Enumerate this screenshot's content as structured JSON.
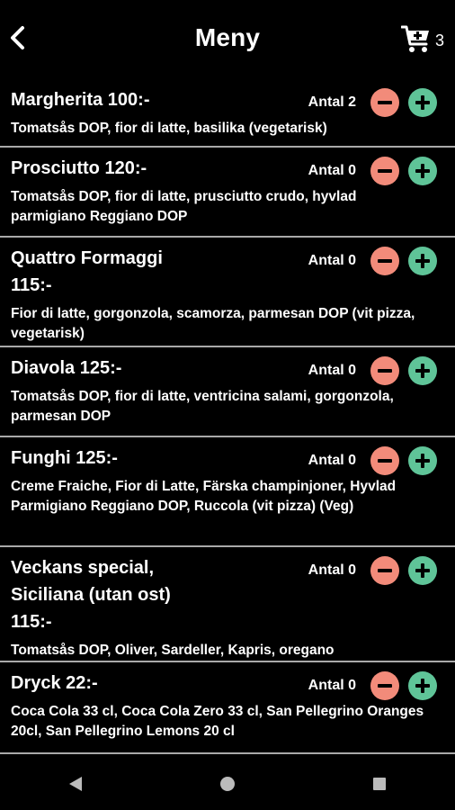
{
  "header": {
    "title": "Meny",
    "cart_count": "3"
  },
  "items": [
    {
      "name": "Margherita 100:-",
      "qty_label": "Antal 2",
      "desc": "Tomatsås DOP, fior di latte, basilika (vegetarisk)"
    },
    {
      "name": "Prosciutto 120:-",
      "qty_label": "Antal 0",
      "desc": "Tomatsås DOP, fior di latte, prusciutto crudo, hyvlad parmigiano Reggiano DOP"
    },
    {
      "name": "Quattro Formaggi 115:-",
      "qty_label": "Antal 0",
      "desc": "Fior di latte, gorgonzola, scamorza, parmesan DOP (vit pizza, vegetarisk)"
    },
    {
      "name": "Diavola 125:-",
      "qty_label": "Antal 0",
      "desc": "Tomatsås DOP, fior di latte, ventricina salami, gorgonzola, parmesan DOP"
    },
    {
      "name": "Funghi 125:-",
      "qty_label": "Antal 0",
      "desc": "Creme Fraiche, Fior di Latte, Färska champinjoner, Hyvlad Parmigiano Reggiano DOP, Ruccola (vit pizza) (Veg)"
    },
    {
      "name": "Veckans special, Siciliana (utan ost) 115:-",
      "qty_label": "Antal 0",
      "desc": "Tomatsås DOP, Oliver, Sardeller, Kapris, oregano"
    },
    {
      "name": "Dryck 22:-",
      "qty_label": "Antal 0",
      "desc": "Coca Cola 33 cl, Coca Cola Zero 33 cl, San Pellegrino Oranges 20cl, San Pellegrino Lemons 20 cl"
    }
  ],
  "colors": {
    "minus": "#f28b7a",
    "plus": "#5fc498",
    "divider": "#a9a9a9"
  }
}
